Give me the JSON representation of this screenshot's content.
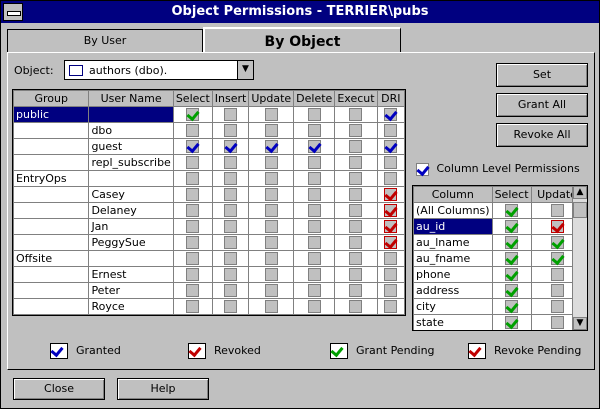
{
  "window": {
    "title": "Object Permissions - TERRIER\\pubs"
  },
  "tabs": [
    {
      "label": "By User"
    },
    {
      "label": "By Object"
    }
  ],
  "object": {
    "label": "Object:",
    "value": "authors (dbo)."
  },
  "buttons": {
    "set": "Set",
    "grant_all": "Grant All",
    "revoke_all": "Revoke All",
    "close": "Close",
    "help": "Help"
  },
  "perm_grid": {
    "headers": [
      "Group",
      "User Name",
      "Select",
      "Insert",
      "Update",
      "Delete",
      "Execut",
      "DRI"
    ],
    "rows": [
      {
        "group": "public",
        "user": "",
        "p": [
          "p",
          "",
          "",
          "",
          "",
          "g"
        ]
      },
      {
        "group": "",
        "user": "dbo",
        "p": [
          "",
          "",
          "",
          "",
          "",
          ""
        ]
      },
      {
        "group": "",
        "user": "guest",
        "p": [
          "g",
          "g",
          "g",
          "g",
          "",
          "g"
        ]
      },
      {
        "group": "",
        "user": "repl_subscribe",
        "p": [
          "",
          "",
          "",
          "",
          "",
          ""
        ]
      },
      {
        "group": "EntryOps",
        "user": "",
        "p": [
          "",
          "",
          "",
          "",
          "",
          ""
        ]
      },
      {
        "group": "",
        "user": "Casey",
        "p": [
          "",
          "",
          "",
          "",
          "",
          "r"
        ]
      },
      {
        "group": "",
        "user": "Delaney",
        "p": [
          "",
          "",
          "",
          "",
          "",
          "r"
        ]
      },
      {
        "group": "",
        "user": "Jan",
        "p": [
          "",
          "",
          "",
          "",
          "",
          "r"
        ]
      },
      {
        "group": "",
        "user": "PeggySue",
        "p": [
          "",
          "",
          "",
          "",
          "",
          "r"
        ]
      },
      {
        "group": "Offsite",
        "user": "",
        "p": [
          "",
          "",
          "",
          "",
          "",
          ""
        ]
      },
      {
        "group": "",
        "user": "Ernest",
        "p": [
          "",
          "",
          "",
          "",
          "",
          ""
        ]
      },
      {
        "group": "",
        "user": "Peter",
        "p": [
          "",
          "",
          "",
          "",
          "",
          ""
        ]
      },
      {
        "group": "",
        "user": "Royce",
        "p": [
          "",
          "",
          "",
          "",
          "",
          ""
        ]
      }
    ]
  },
  "column_perms": {
    "label": "Column Level Permissions"
  },
  "col_grid": {
    "headers": [
      "Column",
      "Select",
      "Update"
    ],
    "rows": [
      {
        "name": "(All Columns)",
        "p": [
          "p",
          ""
        ]
      },
      {
        "name": "au_id",
        "p": [
          "p",
          "r"
        ]
      },
      {
        "name": "au_lname",
        "p": [
          "p",
          "p"
        ]
      },
      {
        "name": "au_fname",
        "p": [
          "p",
          "p"
        ]
      },
      {
        "name": "phone",
        "p": [
          "p",
          ""
        ]
      },
      {
        "name": "address",
        "p": [
          "p",
          ""
        ]
      },
      {
        "name": "city",
        "p": [
          "p",
          ""
        ]
      },
      {
        "name": "state",
        "p": [
          "p",
          ""
        ]
      }
    ]
  },
  "legend": {
    "granted": "Granted",
    "revoked": "Revoked",
    "grant_pending": "Grant Pending",
    "revoke_pending": "Revoke Pending"
  }
}
